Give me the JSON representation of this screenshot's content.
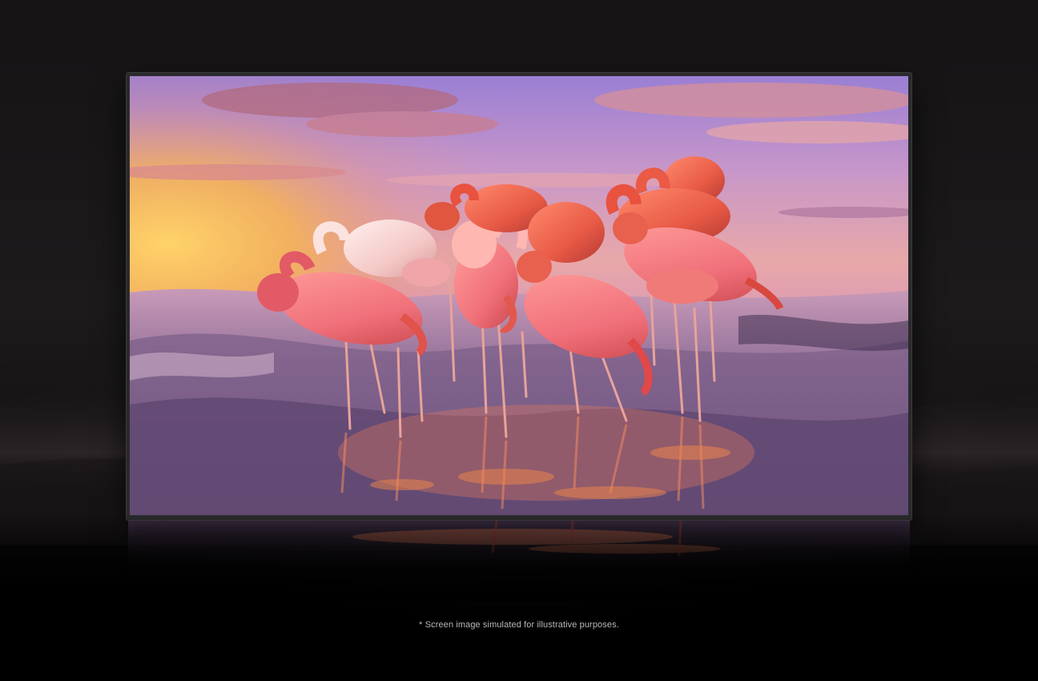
{
  "disclaimer": {
    "text": "* Screen image simulated for illustrative purposes."
  },
  "colors": {
    "background": "#000000",
    "frame": "#2a2a2c",
    "sky_top": "#9c7fd0",
    "sky_glow": "#f3b34a",
    "flamingo_pink": "#f0828a",
    "flamingo_deep": "#e04a3e",
    "water": "#7a5f8c",
    "disclaimer_text": "#b9b9b9"
  },
  "scene": {
    "subject": "flamingo-flock-icon",
    "display": "tv-icon"
  }
}
